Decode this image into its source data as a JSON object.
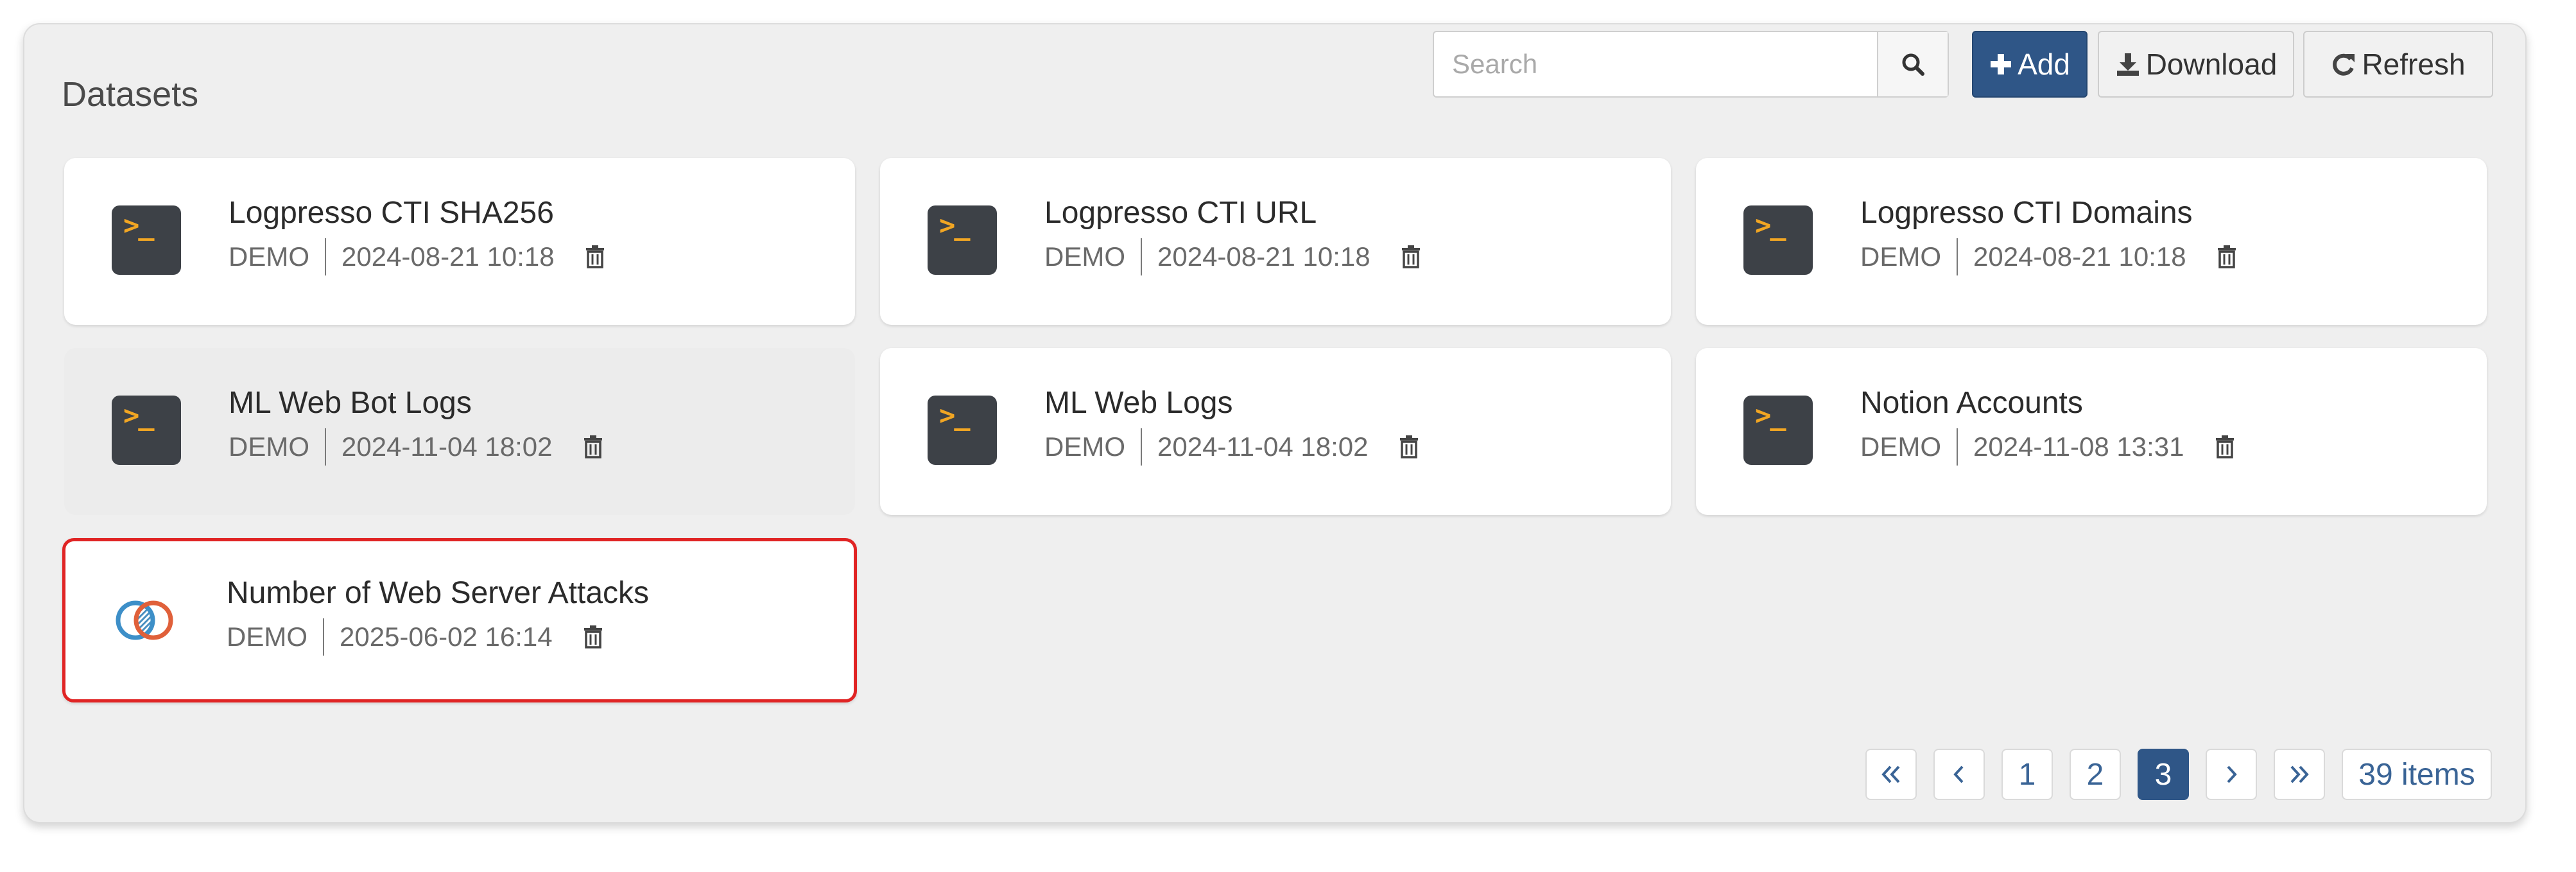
{
  "header": {
    "title": "Datasets",
    "search_placeholder": "Search",
    "search_value": "",
    "add_label": "Add",
    "download_label": "Download",
    "refresh_label": "Refresh",
    "accent_color": "#2f5687"
  },
  "datasets": [
    {
      "name": "Logpresso CTI SHA256",
      "owner": "DEMO",
      "updated": "2024-08-21 10:18",
      "icon": "terminal-icon"
    },
    {
      "name": "Logpresso CTI URL",
      "owner": "DEMO",
      "updated": "2024-08-21 10:18",
      "icon": "terminal-icon"
    },
    {
      "name": "Logpresso CTI Domains",
      "owner": "DEMO",
      "updated": "2024-08-21 10:18",
      "icon": "terminal-icon"
    },
    {
      "name": "ML Web Bot Logs",
      "owner": "DEMO",
      "updated": "2024-11-04 18:02",
      "icon": "terminal-icon"
    },
    {
      "name": "ML Web Logs",
      "owner": "DEMO",
      "updated": "2024-11-04 18:02",
      "icon": "terminal-icon"
    },
    {
      "name": "Notion Accounts",
      "owner": "DEMO",
      "updated": "2024-11-08 13:31",
      "icon": "terminal-icon"
    },
    {
      "name": "Number of Web Server Attacks",
      "owner": "DEMO",
      "updated": "2025-06-02 16:14",
      "icon": "join-icon"
    }
  ],
  "pagination": {
    "pages": [
      "1",
      "2",
      "3"
    ],
    "current": "3",
    "total_label": "39 items"
  }
}
